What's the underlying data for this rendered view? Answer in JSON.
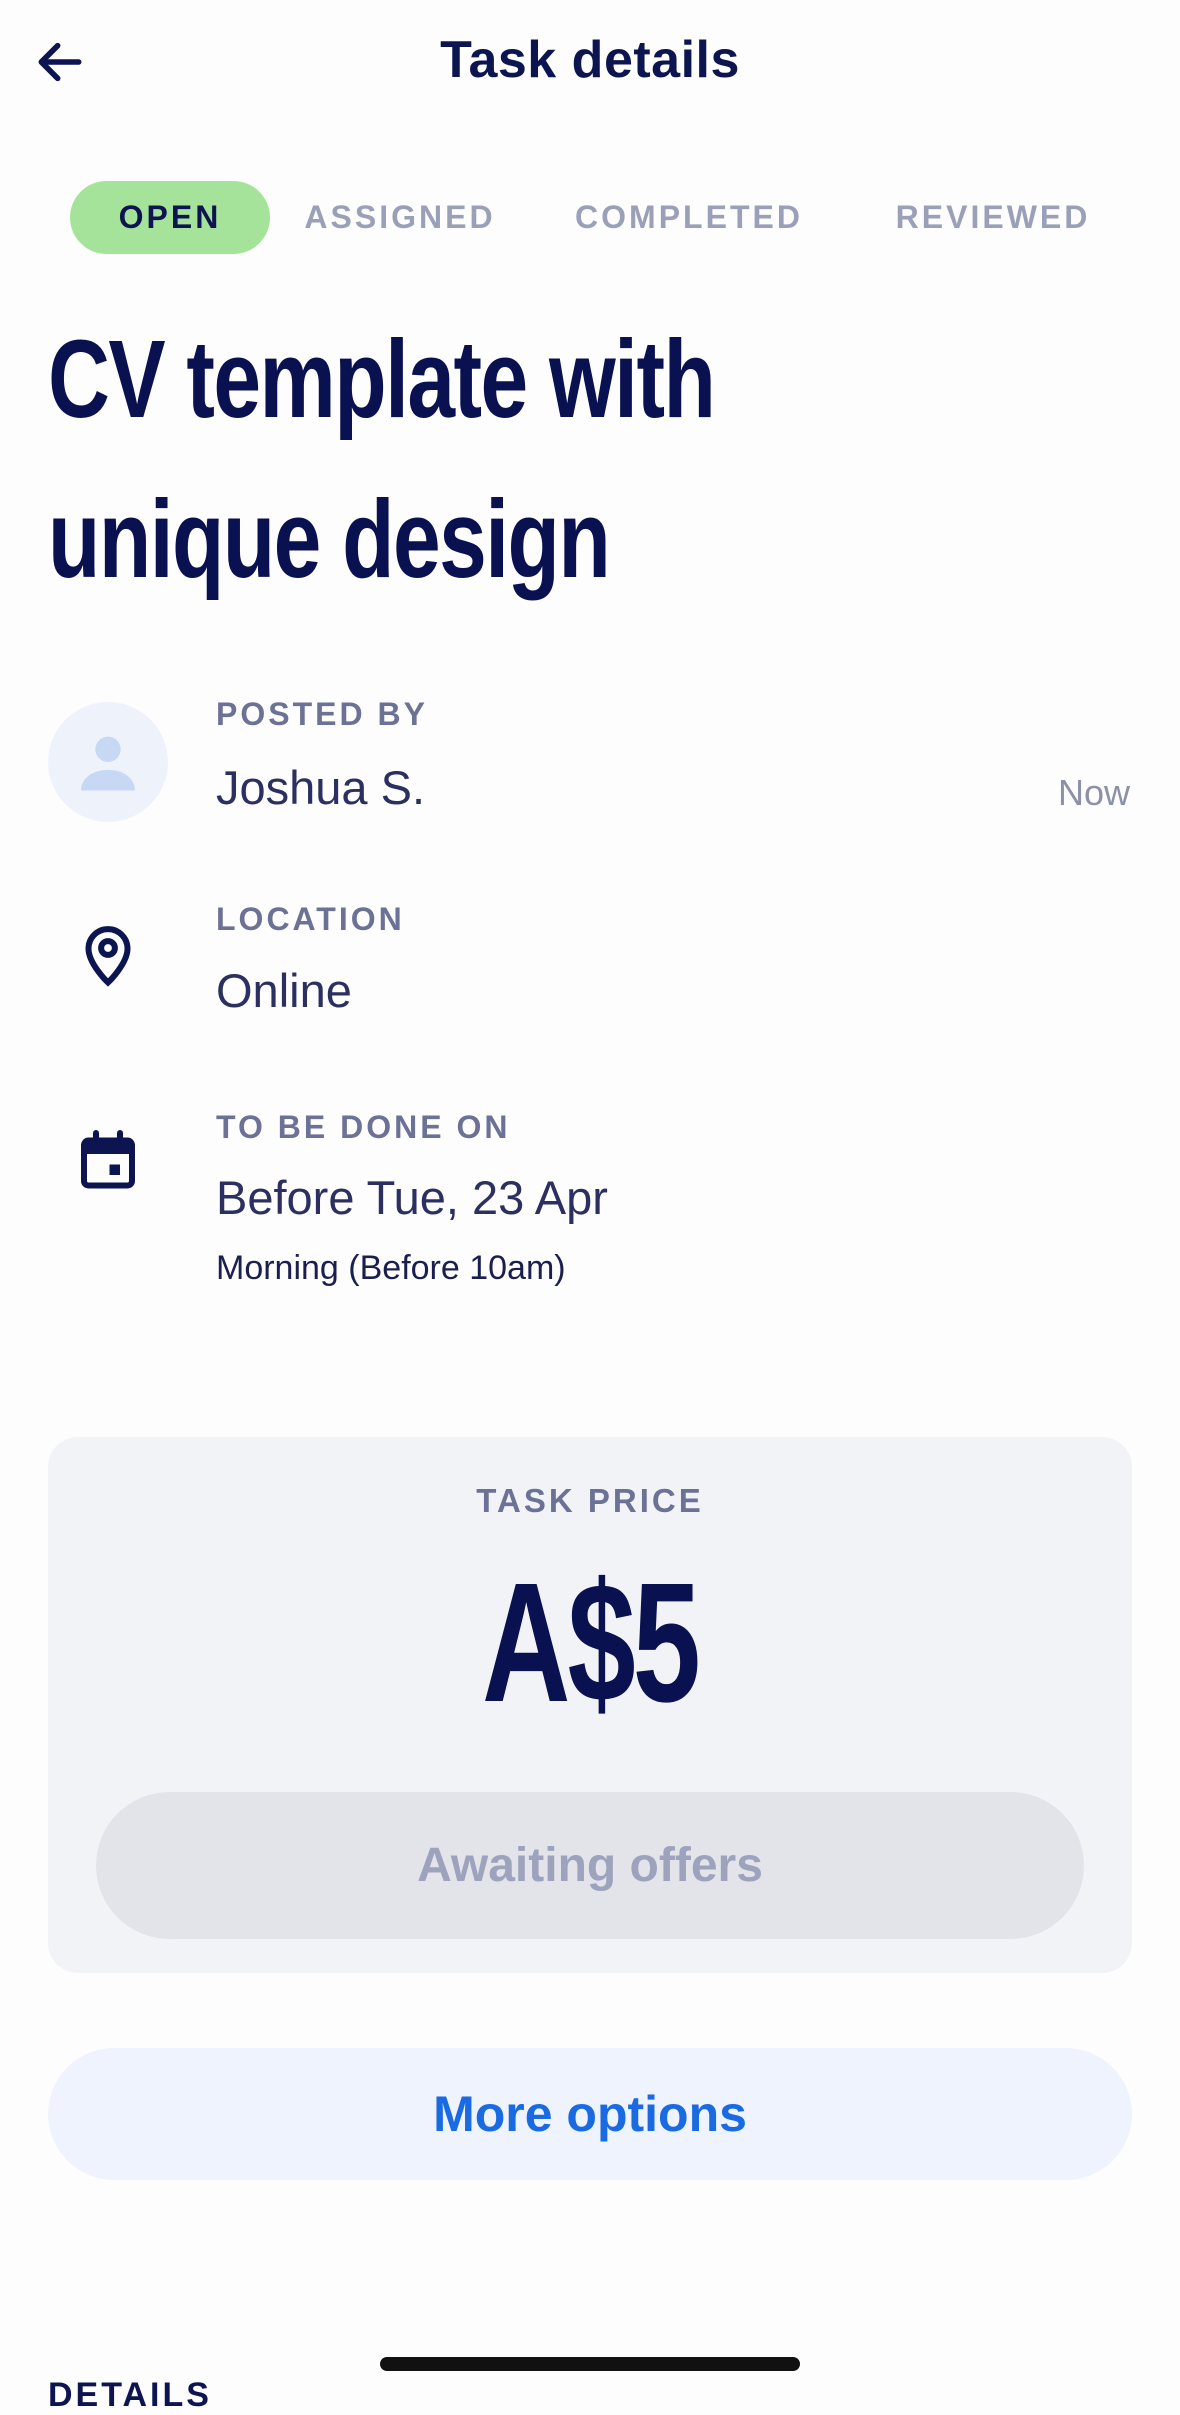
{
  "header": {
    "title": "Task details",
    "back_icon": "arrow-left-icon"
  },
  "status_tabs": [
    {
      "label": "OPEN",
      "active": true
    },
    {
      "label": "ASSIGNED",
      "active": false
    },
    {
      "label": "COMPLETED",
      "active": false
    },
    {
      "label": "REVIEWED",
      "active": false
    }
  ],
  "task": {
    "title_line1": "CV template with",
    "title_line2": "unique design"
  },
  "posted_by": {
    "label": "POSTED BY",
    "name": "Joshua S.",
    "time": "Now",
    "avatar_icon": "user-silhouette-icon"
  },
  "location": {
    "label": "LOCATION",
    "value": "Online",
    "icon": "map-pin-icon"
  },
  "schedule": {
    "label": "TO BE DONE ON",
    "value": "Before Tue, 23 Apr",
    "sub": "Morning (Before 10am)",
    "icon": "calendar-icon"
  },
  "price": {
    "label": "TASK PRICE",
    "value": "A$5",
    "status_button": "Awaiting offers"
  },
  "more_options": {
    "label": "More options"
  },
  "details_section": {
    "heading": "DETAILS"
  },
  "colors": {
    "primary_text": "#0d1551",
    "open_badge": "#a6e39a",
    "link_blue": "#1a6ae2",
    "muted": "#9aa0b8"
  }
}
